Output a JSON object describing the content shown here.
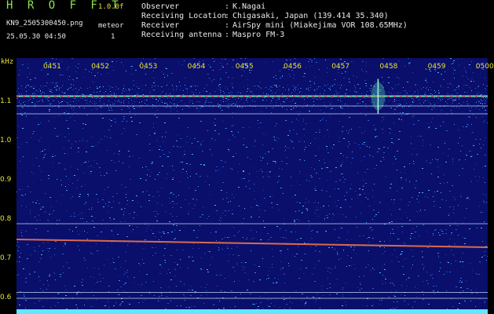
{
  "header": {
    "logo": "H R O F F T",
    "version": "1.0.0f",
    "filename": "KN9_2505300450.png",
    "meteor_label": "meteor",
    "meteor_count": "1",
    "datetime": "25.05.30 04:50",
    "info": [
      {
        "label": "Observer",
        "value": "K.Nagai"
      },
      {
        "label": "Receiving Location",
        "value": "Chigasaki, Japan (139.414 35.340)"
      },
      {
        "label": "Receiver",
        "value": "AirSpy mini (Miakejima VOR 108.65MHz)"
      },
      {
        "label": "Receiving antenna",
        "value": "Maspro FM-3"
      }
    ],
    "separator": ":"
  },
  "chart_data": {
    "type": "heatmap",
    "ylabel": "kHz",
    "y_ticks": [
      "1.1",
      "1.0",
      "0.9",
      "0.8",
      "0.7",
      "0.6"
    ],
    "x_ticks": [
      "0451",
      "0452",
      "0453",
      "0454",
      "0455",
      "0456",
      "0457",
      "0458",
      "0459",
      "0500"
    ],
    "ylim": [
      0.58,
      1.19
    ],
    "colors": {
      "background": "#0a0f6b",
      "tick": "#e6e23a",
      "line": "#ffffff",
      "signal": "#ff4a3a"
    },
    "carriers_khz": [
      1.115,
      1.09,
      1.07,
      0.79,
      0.615,
      0.6
    ],
    "drift_trace": {
      "start_khz": 0.75,
      "end_khz": 0.73
    },
    "meteor_events": [
      {
        "time": "0458",
        "khz": 1.115
      }
    ]
  }
}
